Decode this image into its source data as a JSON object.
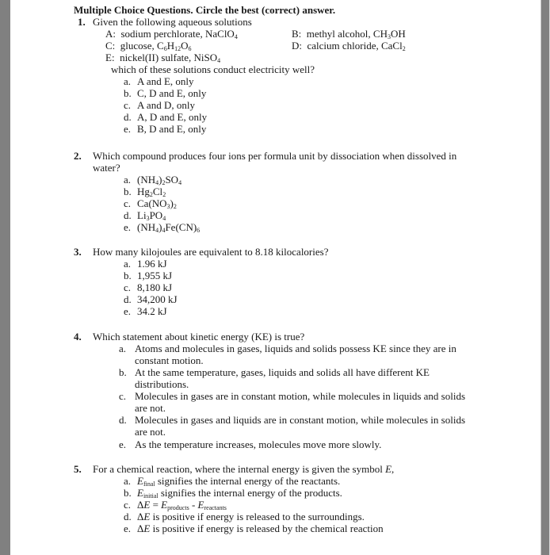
{
  "header": {
    "title": "Multiple Choice Questions.  Circle the best (correct) answer."
  },
  "questions": [
    {
      "number": "1.",
      "stem": "Given the following aqueous solutions",
      "solutions": {
        "A_label": "A:",
        "A_text": "sodium perchlorate, NaClO",
        "A_sub": "4",
        "B_label": "B:",
        "B_text": "methyl alcohol, CH",
        "B_sub": "3",
        "B_tail": "OH",
        "C_label": "C:",
        "C_text": "glucose, C",
        "C_sub1": "6",
        "C_mid1": "H",
        "C_sub2": "12",
        "C_mid2": "O",
        "C_sub3": "6",
        "D_label": "D:",
        "D_text": "calcium chloride, CaCl",
        "D_sub": "2",
        "E_label": "E:",
        "E_text": "nickel(II) sulfate, NiSO",
        "E_sub": "4"
      },
      "prompt": "which of these solutions conduct electricity well?",
      "options": [
        {
          "letter": "a.",
          "text": "A and E, only"
        },
        {
          "letter": "b.",
          "text": "C, D and E, only"
        },
        {
          "letter": "c.",
          "text": "A and D, only"
        },
        {
          "letter": "d.",
          "text": "A, D and E, only"
        },
        {
          "letter": "e.",
          "text": "B, D and E, only"
        }
      ]
    },
    {
      "number": "2.",
      "stem_line1": "Which compound produces four ions per formula unit by dissociation when dissolved in",
      "stem_line2": "water?",
      "options": [
        {
          "letter": "a.",
          "parts": [
            "(NH",
            "4",
            ")",
            "2",
            "SO",
            "4"
          ]
        },
        {
          "letter": "b.",
          "parts": [
            "Hg",
            "2",
            "Cl",
            "2"
          ]
        },
        {
          "letter": "c.",
          "parts": [
            "Ca(NO",
            "3",
            ")",
            "2"
          ]
        },
        {
          "letter": "d.",
          "parts": [
            "Li",
            "3",
            "PO",
            "4"
          ]
        },
        {
          "letter": "e.",
          "parts": [
            "(NH",
            "4",
            ")",
            "4",
            "Fe(CN)",
            "6"
          ]
        }
      ]
    },
    {
      "number": "3.",
      "stem": "How many kilojoules are equivalent to 8.18 kilocalories?",
      "options": [
        {
          "letter": "a.",
          "text": "1.96 kJ"
        },
        {
          "letter": "b.",
          "text": "1,955 kJ"
        },
        {
          "letter": "c.",
          "text": "8,180 kJ"
        },
        {
          "letter": "d.",
          "text": "34,200 kJ"
        },
        {
          "letter": "e.",
          "text": "34.2 kJ"
        }
      ]
    },
    {
      "number": "4.",
      "stem": "Which statement about kinetic energy (KE) is true?",
      "options": [
        {
          "letter": "a.",
          "line1": "Atoms and molecules in gases, liquids and solids possess KE since they are in",
          "line2": "constant motion."
        },
        {
          "letter": "b.",
          "line1": "At the same temperature, gases, liquids and solids all have different KE",
          "line2": "distributions."
        },
        {
          "letter": "c.",
          "line1": "Molecules in gases are in constant motion, while molecules in liquids and solids",
          "line2": "are not."
        },
        {
          "letter": "d.",
          "line1": "Molecules in gases and liquids are in constant motion, while molecules in solids",
          "line2": "are not."
        },
        {
          "letter": "e.",
          "line1": "As the temperature increases, molecules move more slowly."
        }
      ]
    },
    {
      "number": "5.",
      "stem_pre": "For a chemical reaction, where the internal energy is given the symbol ",
      "stem_sym": "E",
      "stem_post": ",",
      "options": [
        {
          "letter": "a.",
          "sym": "E",
          "sub": "final",
          "text": " signifies the internal energy of the reactants."
        },
        {
          "letter": "b.",
          "sym": "E",
          "sub": "initial",
          "text": " signifies the internal energy of the products."
        },
        {
          "letter": "c.",
          "delta": "Δ",
          "sym": "E",
          "eq": " = ",
          "sym2": "E",
          "sub2": "products",
          "minus": " - ",
          "sym3": "E",
          "sub3": "reactants"
        },
        {
          "letter": "d.",
          "delta": "Δ",
          "sym": "E",
          "text": " is positive if energy is released to the surroundings."
        },
        {
          "letter": "e.",
          "delta": "Δ",
          "sym": "E",
          "text": " is positive if energy is released by the chemical reaction"
        }
      ]
    }
  ]
}
